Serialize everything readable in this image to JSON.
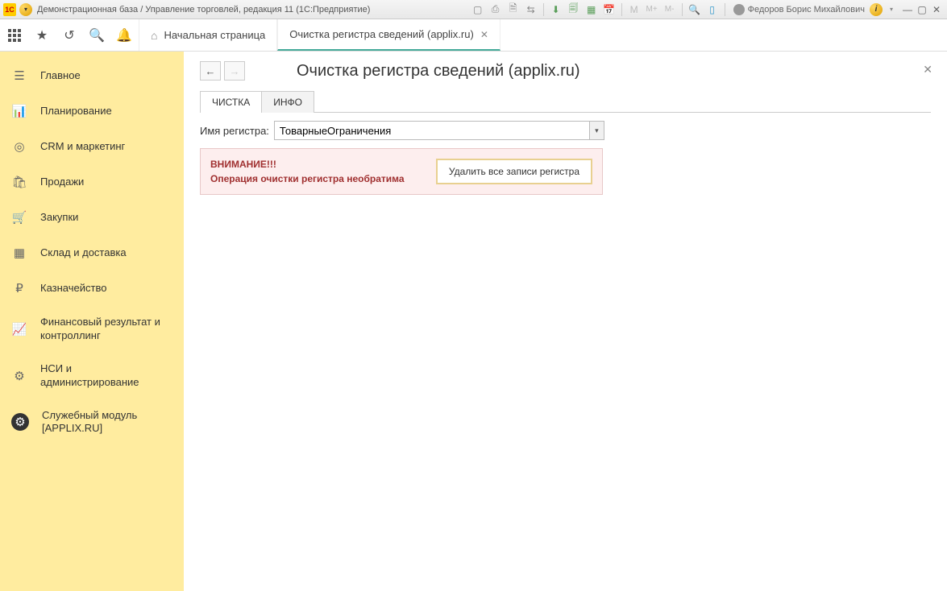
{
  "titlebar": {
    "logo": "1С",
    "title": "Демонстрационная база / Управление торговлей, редакция 11  (1С:Предприятие)",
    "m_labels": [
      "M",
      "M+",
      "M-"
    ],
    "user": "Федоров Борис Михайлович"
  },
  "appbar": {
    "tabs": [
      {
        "label": "Начальная страница",
        "home": true,
        "active": false
      },
      {
        "label": "Очистка регистра сведений (applix.ru)",
        "home": false,
        "active": true,
        "closable": true
      }
    ]
  },
  "sidebar": {
    "items": [
      {
        "icon": "menu",
        "label": "Главное"
      },
      {
        "icon": "planning",
        "label": "Планирование"
      },
      {
        "icon": "crm",
        "label": "CRM и маркетинг"
      },
      {
        "icon": "sales",
        "label": "Продажи"
      },
      {
        "icon": "purchase",
        "label": "Закупки"
      },
      {
        "icon": "warehouse",
        "label": "Склад и доставка"
      },
      {
        "icon": "treasury",
        "label": "Казначейство"
      },
      {
        "icon": "finance",
        "label": "Финансовый результат и контроллинг"
      },
      {
        "icon": "nsi",
        "label": "НСИ и администрирование"
      },
      {
        "icon": "service",
        "label": "Служебный модуль [APPLIX.RU]",
        "active": true
      }
    ]
  },
  "page": {
    "title": "Очистка регистра сведений (applix.ru)",
    "tabs": [
      {
        "label": "ЧИСТКА",
        "active": true
      },
      {
        "label": "ИНФО",
        "active": false
      }
    ],
    "field_label": "Имя регистра:",
    "field_value": "ТоварныеОграничения",
    "warning_line1": "ВНИМАНИЕ!!!",
    "warning_line2": "Операция очистки регистра необратима",
    "delete_button": "Удалить все записи регистра"
  }
}
